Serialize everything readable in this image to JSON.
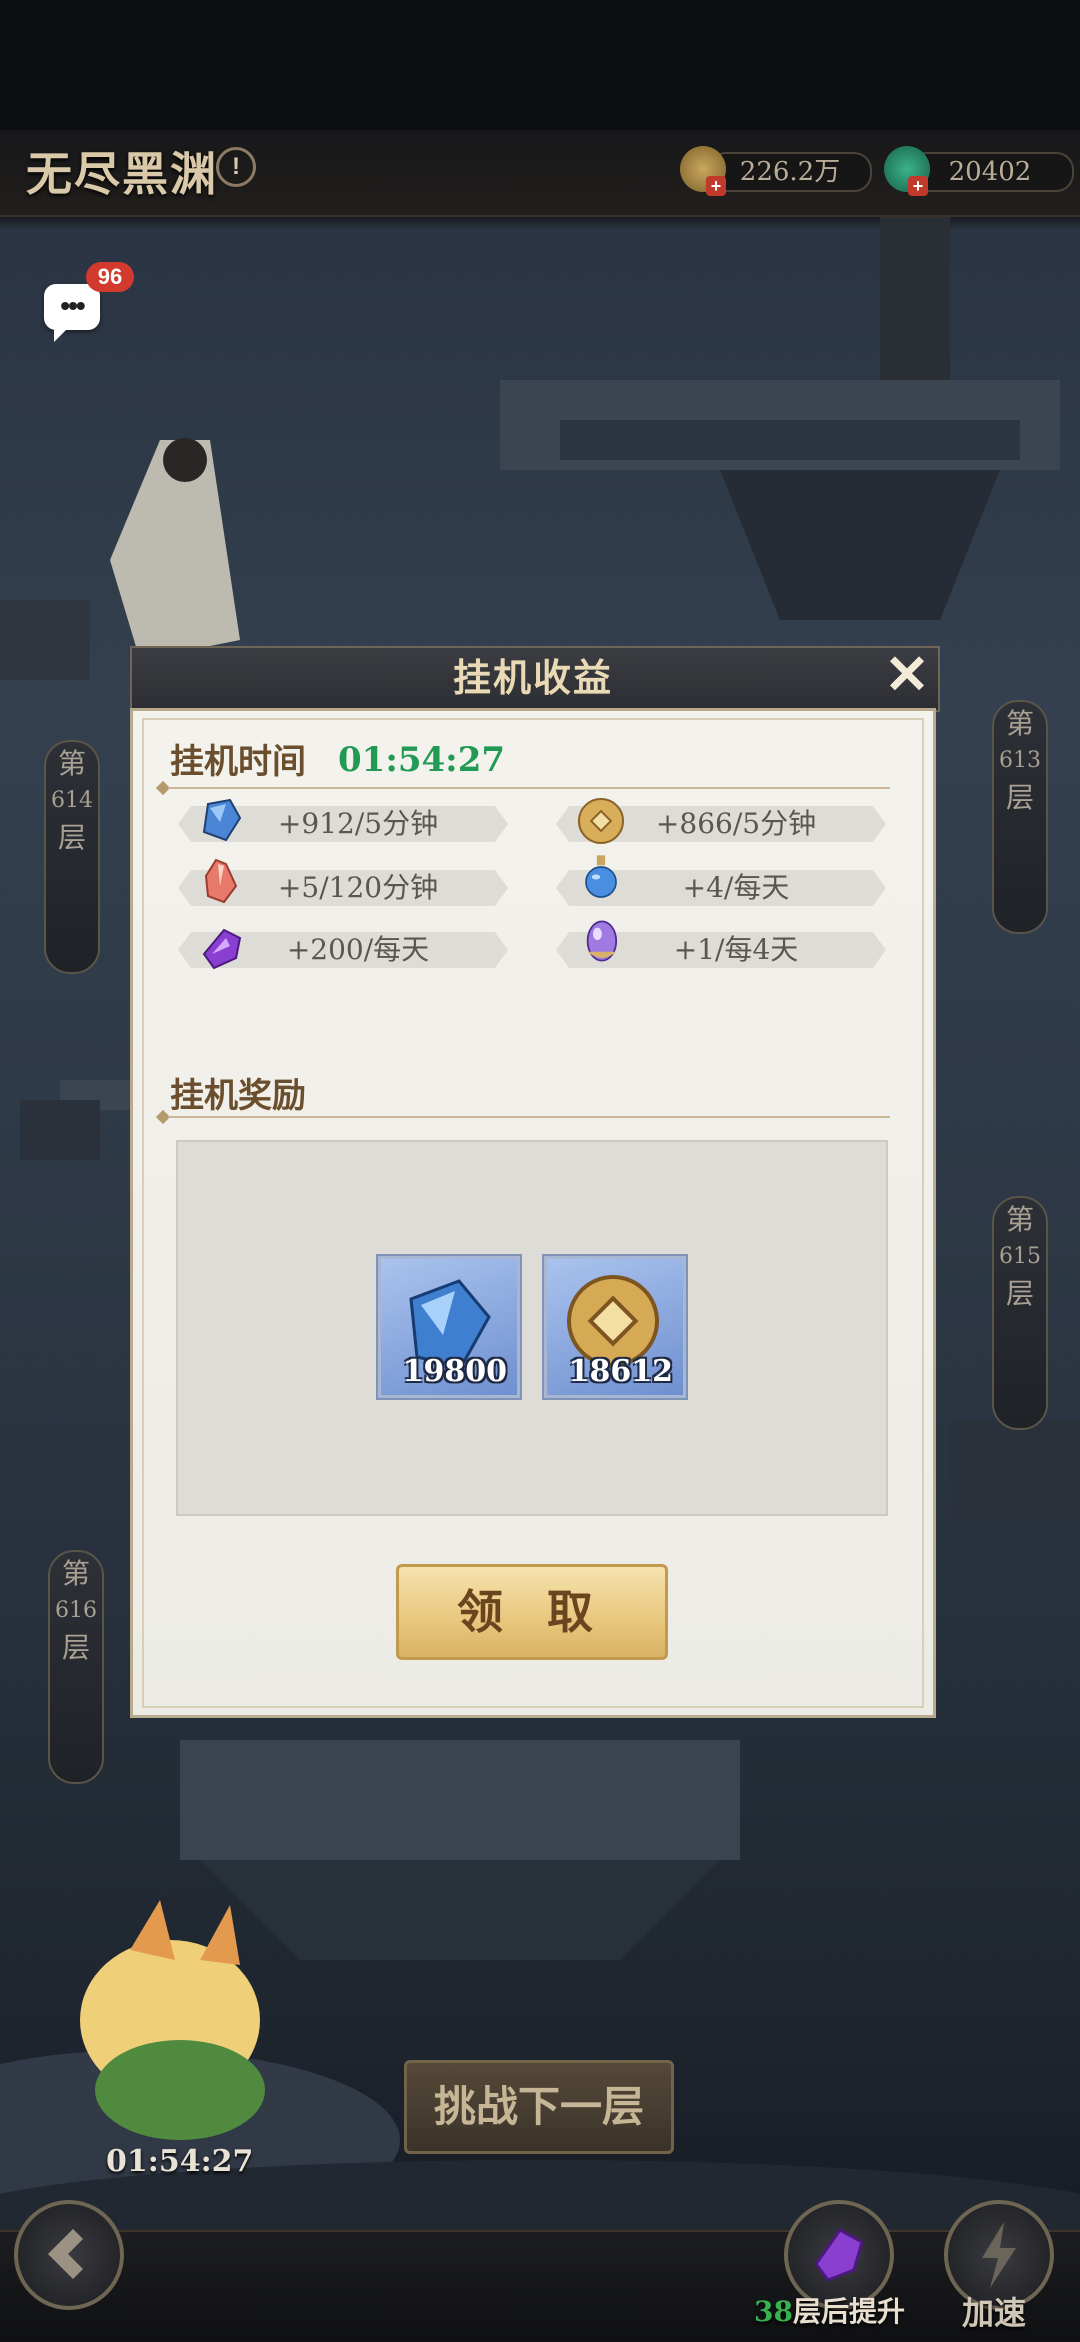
{
  "header": {
    "title": "无尽黑渊",
    "info_icon": "!",
    "coins": "226.2万",
    "gems": "20402"
  },
  "chat": {
    "badge": "96"
  },
  "floors": {
    "left_top": {
      "prefix": "第",
      "number": "614",
      "suffix": "层"
    },
    "right_top": {
      "prefix": "第",
      "number": "613",
      "suffix": "层"
    },
    "right_mid": {
      "prefix": "第",
      "number": "615",
      "suffix": "层"
    },
    "left_bottom": {
      "prefix": "第",
      "number": "616",
      "suffix": "层"
    }
  },
  "modal": {
    "title": "挂机收益",
    "close_icon": "close-icon",
    "time_label": "挂机时间",
    "time_value": "01:54:27",
    "rates": [
      {
        "icon": "blue-crystal-icon",
        "text": "+912/5分钟"
      },
      {
        "icon": "gold-coin-icon",
        "text": "+866/5分钟"
      },
      {
        "icon": "red-crystal-icon",
        "text": "+5/120分钟"
      },
      {
        "icon": "blue-potion-icon",
        "text": "+4/每天"
      },
      {
        "icon": "purple-crystal-icon",
        "text": "+200/每天"
      },
      {
        "icon": "purple-egg-icon",
        "text": "+1/每4天"
      }
    ],
    "reward_label": "挂机奖励",
    "rewards": [
      {
        "icon": "blue-crystal-icon",
        "count": "19800"
      },
      {
        "icon": "gold-coin-icon",
        "count": "18612"
      }
    ],
    "claim_label": "领 取"
  },
  "bottom": {
    "challenge_label": "挑战下一层",
    "pet_timer": "01:54:27",
    "floor_count": "38",
    "floor_suffix": "层后提升",
    "speed_label": "加速"
  }
}
